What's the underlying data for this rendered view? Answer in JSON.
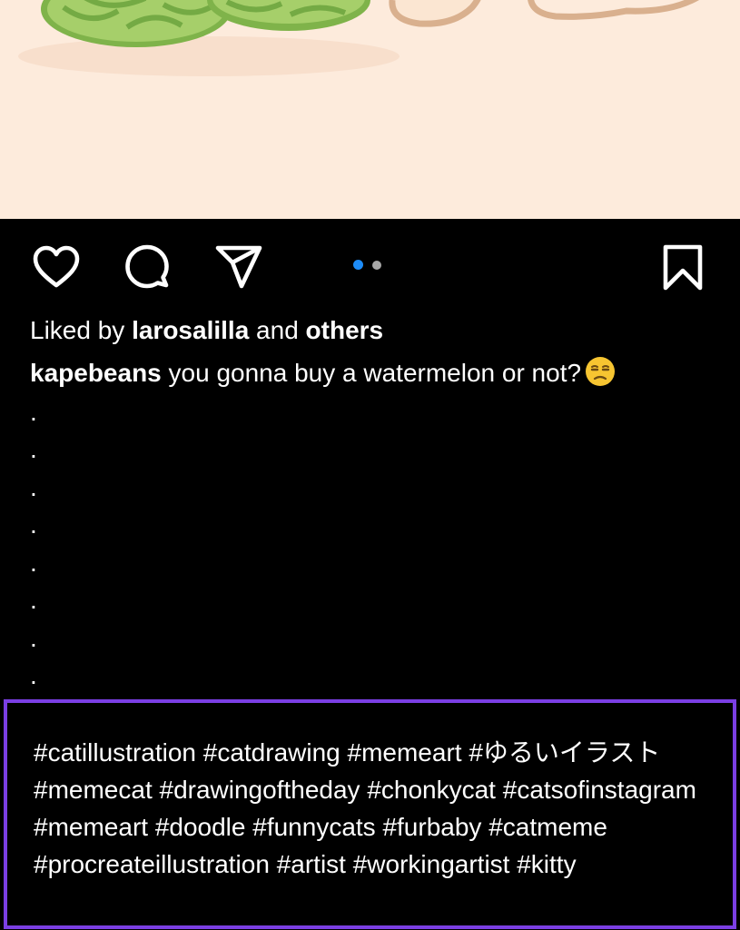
{
  "post": {
    "image_description_icon": "watermelon-illustration",
    "background_color": "#fdebdc"
  },
  "actions": {
    "like_icon": "heart-icon",
    "comment_icon": "comment-bubble-icon",
    "share_icon": "paper-plane-icon",
    "save_icon": "bookmark-icon",
    "carousel": {
      "total": 2,
      "active": 1,
      "active_color": "#1d8cf8",
      "inactive_color": "#a8a8a8"
    }
  },
  "likes": {
    "prefix": "Liked by ",
    "user": "larosalilla",
    "middle": " and ",
    "others": "others"
  },
  "caption": {
    "username": "kapebeans",
    "text": " you gonna buy a watermelon or not?",
    "emoji": "unamused-face-icon"
  },
  "caption_dots": [
    ".",
    ".",
    ".",
    ".",
    ".",
    ".",
    ".",
    "."
  ],
  "hashtags": {
    "text": "#catillustration #catdrawing #memeart #ゆるいイラスト #memecat #drawingoftheday #chonkycat #catsofinstagram #memeart #doodle #funnycats #furbaby #catmeme #procreateillustration #artist #workingartist  #kitty",
    "highlight_color": "#7b3fe4"
  }
}
